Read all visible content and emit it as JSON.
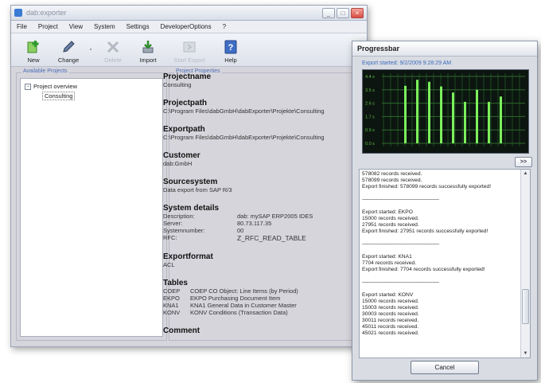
{
  "window": {
    "title": "dab:exporter",
    "controls": [
      "_",
      "□",
      "×"
    ]
  },
  "menu": [
    "File",
    "Project",
    "View",
    "System",
    "Settings",
    "DeveloperOptions",
    "?"
  ],
  "toolbar": {
    "buttons": [
      {
        "label": "New",
        "icon": "plus-icon",
        "enabled": true
      },
      {
        "label": "Change",
        "icon": "edit-icon",
        "enabled": true
      },
      {
        "label": "Delete",
        "icon": "delete-x-icon",
        "enabled": false
      },
      {
        "label": "Import",
        "icon": "import-arrow-icon",
        "enabled": true
      },
      {
        "label": "Start Export",
        "icon": "start-export-icon",
        "enabled": false
      },
      {
        "label": "Help",
        "icon": "help-icon",
        "enabled": true
      }
    ]
  },
  "projects_panel": {
    "title": "Available Projects",
    "root": "Project overview",
    "child": "Consulting"
  },
  "properties": {
    "title": "Project Properties",
    "projectname_label": "Projectname",
    "projectname": "Consulting",
    "projectpath_label": "Projectpath",
    "projectpath": "C:\\Program Files\\dabGmbH\\dabExporter\\Projekte\\Consulting",
    "exportpath_label": "Exportpath",
    "exportpath": "C:\\Program Files\\dabGmbH\\dabExporter\\Projekte\\Consulting",
    "customer_label": "Customer",
    "customer": "dab:GmbH",
    "sourcesystem_label": "Sourcesystem",
    "sourcesystem": "Data export from SAP R/3",
    "system_details_label": "System details",
    "system_details": [
      {
        "key": "Description:",
        "value": "dab: mySAP ERP2005 IDES"
      },
      {
        "key": "Server:",
        "value": "80.73.117.35"
      },
      {
        "key": "Systemnumber:",
        "value": "00"
      },
      {
        "key": "RFC:",
        "value": "Z_RFC_READ_TABLE"
      }
    ],
    "exportformat_label": "Exportformat",
    "exportformat": "ACL",
    "tables_label": "Tables",
    "tables": [
      {
        "code": "COEP",
        "desc": "COEP CO Object: Line Items (by Period)"
      },
      {
        "code": "EKPO",
        "desc": "EKPO Purchasing Document Item"
      },
      {
        "code": "KNA1",
        "desc": "KNA1 General Data in Customer Master"
      },
      {
        "code": "KONV",
        "desc": "KONV Conditions (Transaction Data)"
      }
    ],
    "comment_label": "Comment"
  },
  "progress": {
    "title": "Progressbar",
    "started": "Export started: 9/2/2009 9:28:29 AM",
    "chart_ticks": [
      "4.4 s",
      "3.5 s",
      "2.6 s",
      "1.7 s",
      "0.9 s",
      "0.0 s"
    ],
    "chart_bar_levels": [
      0.86,
      0.95,
      0.92,
      0.85,
      0.76,
      0.62,
      0.8,
      0.62,
      0.7
    ],
    "expand_label": ">>",
    "log": [
      "578082 records received.",
      "578099 records received.",
      "Export finished: 578099 records successfully exported!",
      "",
      "--------------------------------------------------------",
      "",
      "Export started: EKPO",
      "15000 records received.",
      "27951 records received.",
      "Export finished: 27951 records successfully exported!",
      "",
      "--------------------------------------------------------",
      "",
      "Export started: KNA1",
      "7704 records received.",
      "Export finished: 7704 records successfully exported!",
      "",
      "--------------------------------------------------------",
      "",
      "Export started: KONV",
      "15000 records received.",
      "15003 records received.",
      "30003 records received.",
      "30011 records received.",
      "45011 records received.",
      "45021 records received."
    ],
    "cancel_label": "Cancel"
  }
}
